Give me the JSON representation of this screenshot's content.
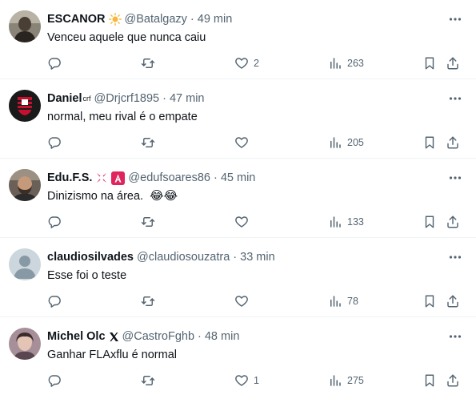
{
  "replies": [
    {
      "name": "ESCANOR",
      "badge": "",
      "handle": "@Batalgazy",
      "separator": "·",
      "time": "49 min",
      "text": "Venceu aquele que nunca caiu",
      "emojis": "",
      "reply_count": "",
      "retweet_count": "",
      "like_count": "2",
      "view_count": "263"
    },
    {
      "name": "Daniel",
      "badge": "crf",
      "handle": "@Drjcrf1895",
      "separator": "·",
      "time": "47 min",
      "text": "normal, meu rival é o empate",
      "emojis": "",
      "reply_count": "",
      "retweet_count": "",
      "like_count": "",
      "view_count": "205"
    },
    {
      "name": "Edu.F.S.",
      "badge": "",
      "handle": "@edufsoares86",
      "separator": "·",
      "time": "45 min",
      "text": "Dinizismo na área.",
      "emojis": "😂😂",
      "reply_count": "",
      "retweet_count": "",
      "like_count": "",
      "view_count": "133"
    },
    {
      "name": "claudiosilvades",
      "badge": "",
      "handle": "@claudiosouzatra",
      "separator": "·",
      "time": "33 min",
      "text": "Esse foi o teste",
      "emojis": "",
      "reply_count": "",
      "retweet_count": "",
      "like_count": "",
      "view_count": "78"
    },
    {
      "name": "Michel Olc",
      "badge": "",
      "handle": "@CastroFghb",
      "separator": "·",
      "time": "48 min",
      "text": "Ganhar FLAxflu é normal",
      "emojis": "",
      "reply_count": "",
      "retweet_count": "",
      "like_count": "1",
      "view_count": "275"
    }
  ],
  "icons": {
    "reply": "reply-icon",
    "retweet": "retweet-icon",
    "like": "heart-icon",
    "views": "views-icon",
    "bookmark": "bookmark-icon",
    "share": "share-icon",
    "more": "more-icon"
  },
  "colors": {
    "text": "#0f1419",
    "secondary": "#536471",
    "divider": "#eff3f4",
    "badge_red": "#e0245e"
  }
}
